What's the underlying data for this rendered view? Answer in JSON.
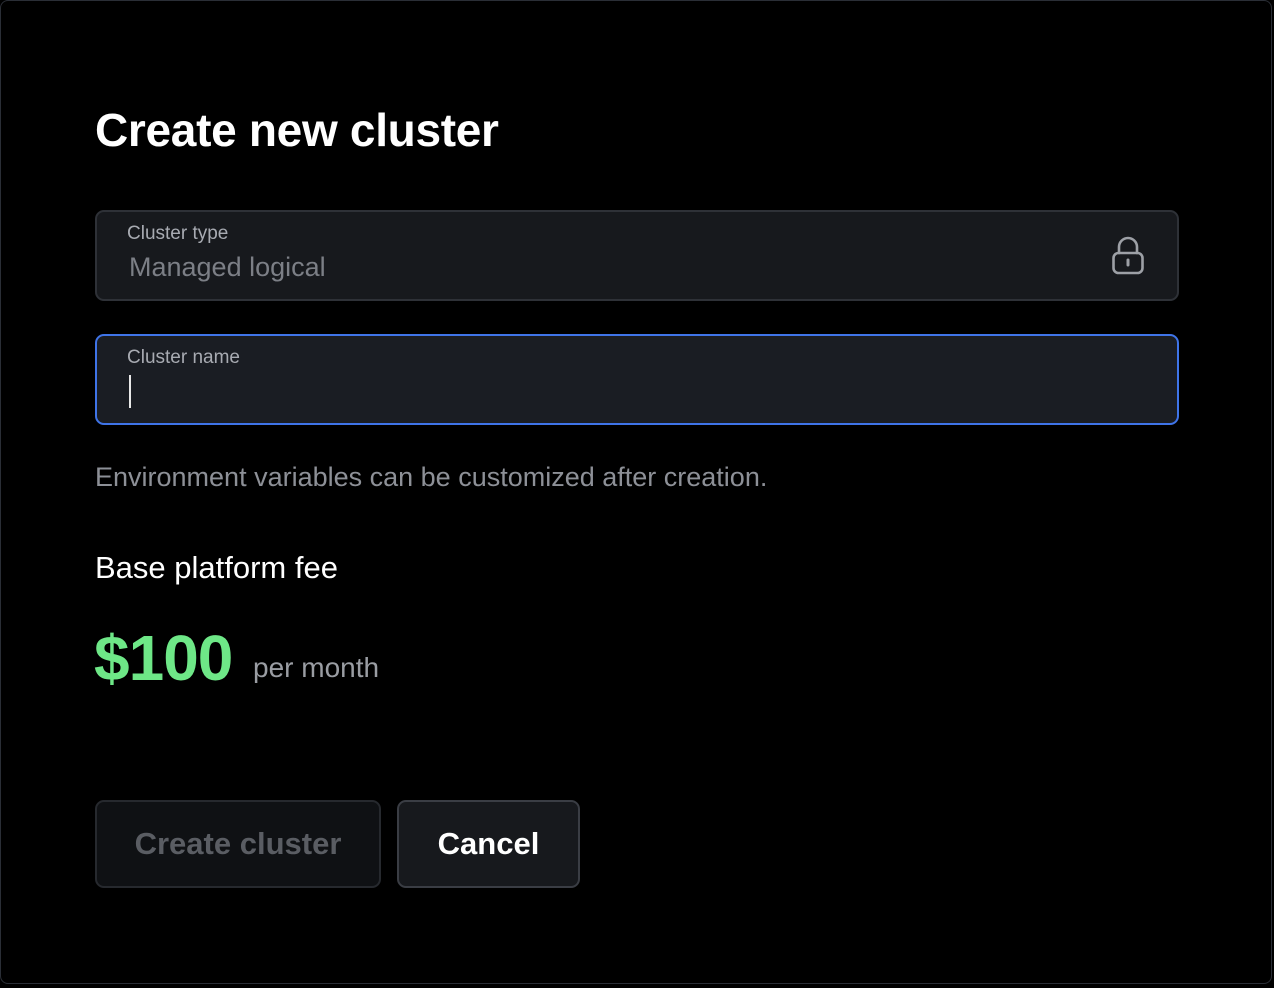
{
  "dialog": {
    "title": "Create new cluster"
  },
  "cluster_type": {
    "label": "Cluster type",
    "value": "Managed logical",
    "icon": "lock-icon",
    "locked": true
  },
  "cluster_name": {
    "label": "Cluster name",
    "value": "",
    "focused": true
  },
  "helper_text": "Environment variables can be customized after creation.",
  "pricing": {
    "label": "Base platform fee",
    "amount": "$100",
    "period": "per month",
    "amount_color": "#6ee787"
  },
  "actions": {
    "create_label": "Create cluster",
    "create_disabled": true,
    "cancel_label": "Cancel"
  },
  "colors": {
    "background": "#000000",
    "focus_border": "#3f74e8",
    "accent_green": "#6ee787"
  }
}
